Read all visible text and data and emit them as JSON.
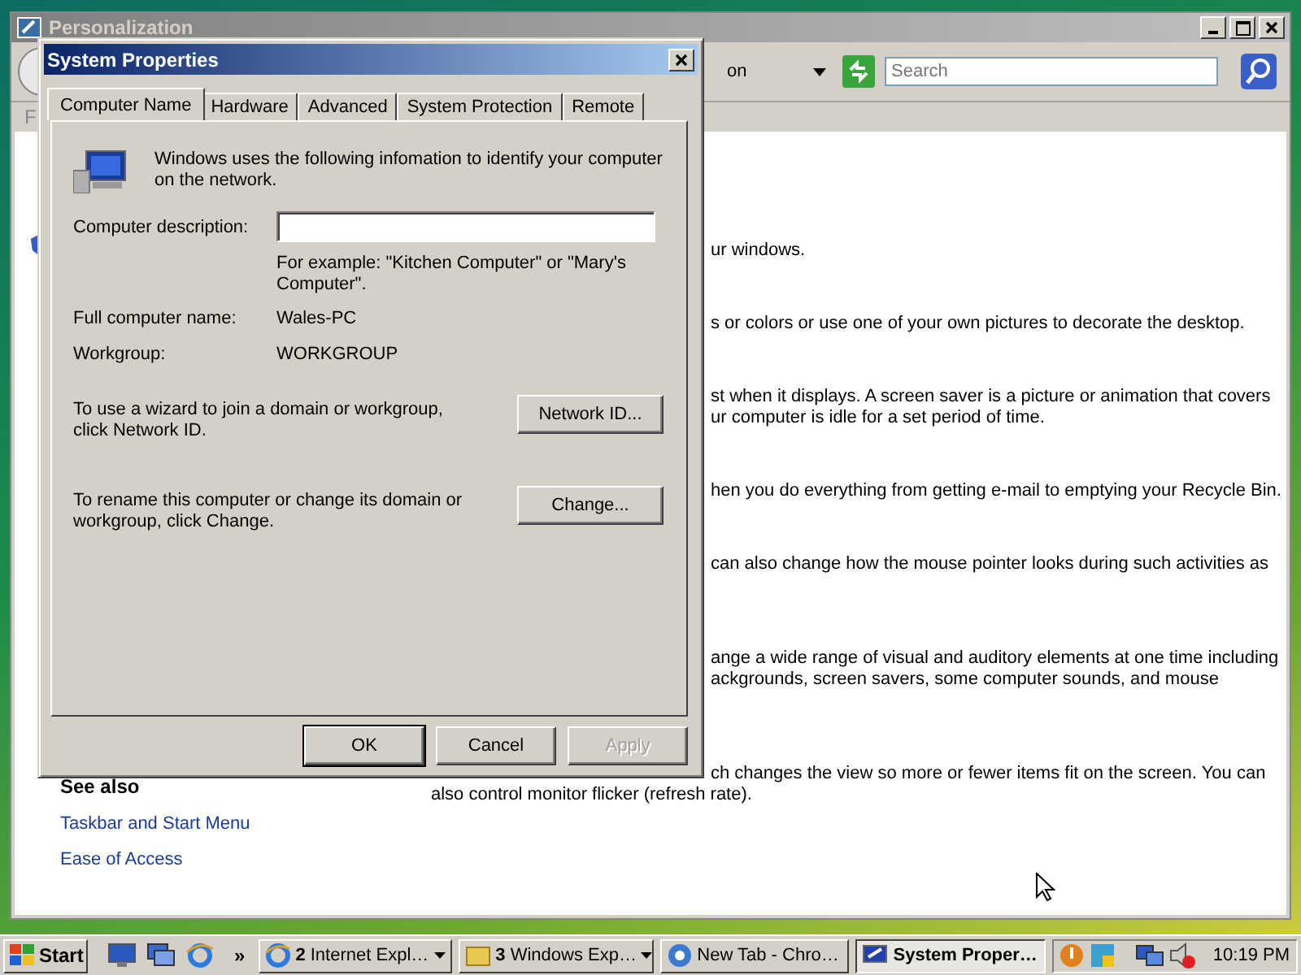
{
  "background_window": {
    "title": "Personalization",
    "address": "on",
    "search": {
      "placeholder": "Search"
    },
    "menu": "F",
    "descriptions": [
      {
        "lines": [
          "ur windows."
        ]
      },
      {
        "lines": [
          "s or colors or use one of your own pictures to decorate the desktop."
        ]
      },
      {
        "lines": [
          "st when it displays. A screen saver is a picture or animation that covers",
          "ur computer is idle for a set period of time."
        ]
      },
      {
        "lines": [
          "hen you do everything from getting e-mail to emptying your Recycle Bin."
        ]
      },
      {
        "lines": [
          "can also change how the mouse pointer looks during such activities as"
        ]
      },
      {
        "lines": [
          "ange a wide range of visual and auditory elements at one time including",
          "ackgrounds, screen savers, some computer sounds, and mouse"
        ]
      },
      {
        "lines": [
          "ch changes the view so more or fewer items fit on the screen. You can"
        ]
      }
    ],
    "last_line": "also control monitor flicker (refresh rate).",
    "see_also": {
      "heading": "See also",
      "links": [
        "Taskbar and Start Menu",
        "Ease of Access"
      ]
    }
  },
  "dialog": {
    "title": "System Properties",
    "tabs": [
      {
        "label": "Computer Name",
        "selected": true
      },
      {
        "label": "Hardware",
        "selected": false
      },
      {
        "label": "Advanced",
        "selected": false
      },
      {
        "label": "System Protection",
        "selected": false
      },
      {
        "label": "Remote",
        "selected": false
      }
    ],
    "intro": "Windows uses the following infomation to identify your computer on the network.",
    "description": {
      "label": "Computer description:",
      "hint": "For example: \"Kitchen Computer\" or \"Mary's Computer\"."
    },
    "info": [
      {
        "label": "Full computer name:",
        "value": "Wales-PC"
      },
      {
        "label": "Workgroup:",
        "value": "WORKGROUP"
      }
    ],
    "actions": [
      {
        "text": "To use a wizard to join a domain or workgroup, click Network ID.",
        "button": "Network ID..."
      },
      {
        "text": "To rename this computer or change its domain or workgroup, click Change.",
        "button": "Change..."
      }
    ],
    "buttons": [
      {
        "label": "OK",
        "default": true,
        "disabled": false
      },
      {
        "label": "Cancel",
        "default": false,
        "disabled": false
      },
      {
        "label": "Apply",
        "default": false,
        "disabled": true
      }
    ]
  },
  "taskbar": {
    "start": "Start",
    "overflow": "»",
    "tasks": [
      {
        "kind": "ie",
        "count": "2",
        "label": "Internet Expl…",
        "grouped": true,
        "selected": false
      },
      {
        "kind": "folder",
        "count": "3",
        "label": "Windows Exp…",
        "grouped": true,
        "selected": false
      },
      {
        "kind": "chrome",
        "label": "New Tab - Chro…",
        "grouped": false,
        "selected": false
      },
      {
        "kind": "system",
        "label": "System Proper…",
        "grouped": false,
        "selected": true
      }
    ],
    "clock": "10:19 PM"
  }
}
